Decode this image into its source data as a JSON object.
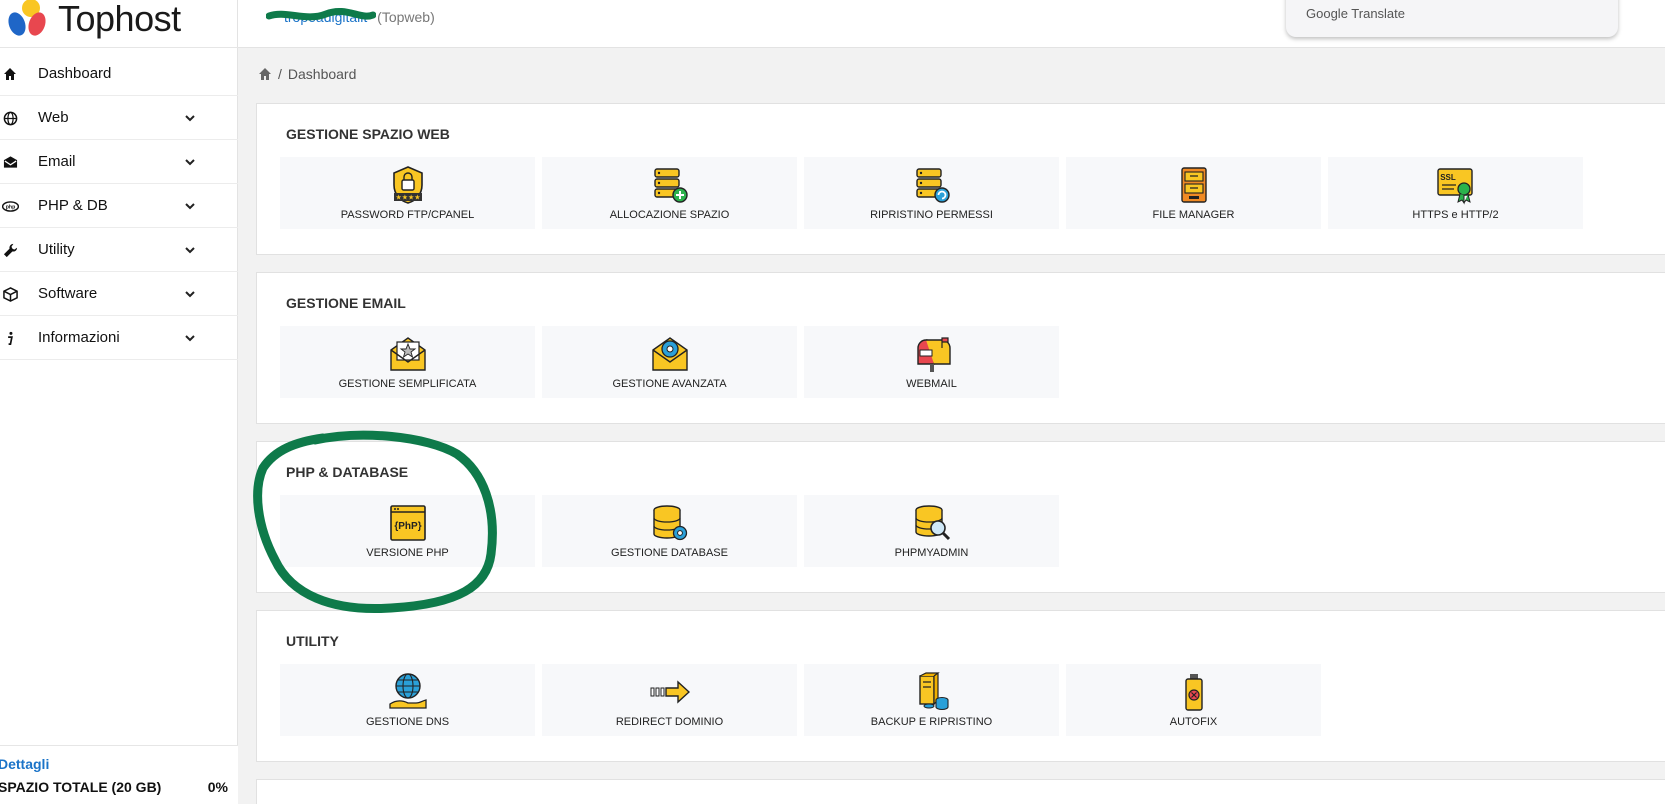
{
  "brand": {
    "name": "Tophost"
  },
  "header": {
    "account_user": "tropeadigitalit",
    "account_plan": "(Topweb)",
    "google_translate": "Google Translate"
  },
  "sidebar": {
    "items": [
      {
        "label": "Dashboard",
        "icon": "home-icon",
        "expandable": false
      },
      {
        "label": "Web",
        "icon": "globe-icon",
        "expandable": true
      },
      {
        "label": "Email",
        "icon": "envelope-icon",
        "expandable": true
      },
      {
        "label": "PHP & DB",
        "icon": "php-icon",
        "expandable": true
      },
      {
        "label": "Utility",
        "icon": "wrench-icon",
        "expandable": true
      },
      {
        "label": "Software",
        "icon": "box-icon",
        "expandable": true
      },
      {
        "label": "Informazioni",
        "icon": "info-icon",
        "expandable": true
      }
    ],
    "space": {
      "details_label": "Dettagli",
      "total_label": "SPAZIO TOTALE (20 GB)",
      "percent": "0%"
    }
  },
  "breadcrumb": {
    "current": "Dashboard"
  },
  "sections": [
    {
      "title": "GESTIONE SPAZIO WEB",
      "tiles": [
        {
          "label": "PASSWORD FTP/CPANEL",
          "icon": "shield-lock-icon"
        },
        {
          "label": "ALLOCAZIONE SPAZIO",
          "icon": "server-add-icon"
        },
        {
          "label": "RIPRISTINO PERMESSI",
          "icon": "server-refresh-icon"
        },
        {
          "label": "FILE MANAGER",
          "icon": "file-manager-icon"
        },
        {
          "label": "HTTPS e HTTP/2",
          "icon": "ssl-certificate-icon"
        }
      ]
    },
    {
      "title": "GESTIONE EMAIL",
      "tiles": [
        {
          "label": "GESTIONE SEMPLIFICATA",
          "icon": "mail-star-icon"
        },
        {
          "label": "GESTIONE AVANZATA",
          "icon": "mail-gear-icon"
        },
        {
          "label": "WEBMAIL",
          "icon": "mailbox-icon"
        }
      ]
    },
    {
      "title": "PHP & DATABASE",
      "tiles": [
        {
          "label": "VERSIONE PHP",
          "icon": "php-file-icon",
          "icon_text": "{PhP}"
        },
        {
          "label": "GESTIONE DATABASE",
          "icon": "database-gear-icon"
        },
        {
          "label": "PHPMYADMIN",
          "icon": "database-search-icon"
        }
      ]
    },
    {
      "title": "UTILITY",
      "tiles": [
        {
          "label": "GESTIONE DNS",
          "icon": "globe-hand-icon"
        },
        {
          "label": "REDIRECT DOMINIO",
          "icon": "redirect-arrow-icon"
        },
        {
          "label": "BACKUP E RIPRISTINO",
          "icon": "backup-icon"
        },
        {
          "label": "AUTOFIX",
          "icon": "autofix-icon"
        }
      ]
    }
  ],
  "colors": {
    "accent_blue": "#1a73c8",
    "icon_yellow": "#f9c623",
    "highlight_green": "#0e7a4a"
  }
}
